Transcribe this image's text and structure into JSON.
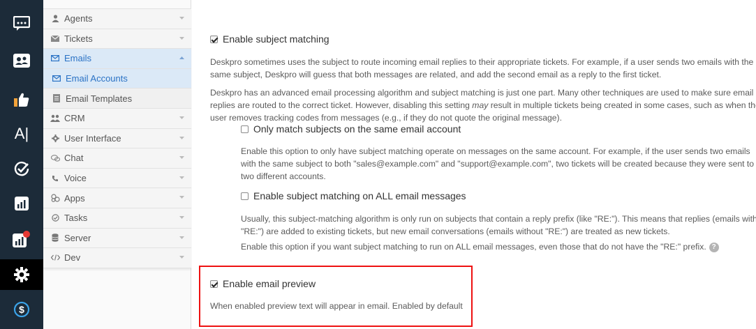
{
  "rail": {
    "items": [
      {
        "icon": "chat-window-icon"
      },
      {
        "icon": "contacts-card-icon"
      },
      {
        "icon": "thumbs-up-icon"
      },
      {
        "icon": "text-cursor-icon",
        "label": "A|"
      },
      {
        "icon": "checkmark-circle-icon"
      },
      {
        "icon": "bar-chart-icon"
      },
      {
        "icon": "bar-chart-notification-icon"
      },
      {
        "icon": "gear-icon",
        "active": true
      },
      {
        "icon": "dollar-circle-icon"
      }
    ],
    "notification_color": "#e53935"
  },
  "sidebar": {
    "items": [
      {
        "label": "Agents",
        "icon": "user-icon"
      },
      {
        "label": "Tickets",
        "icon": "envelope-icon"
      },
      {
        "label": "Emails",
        "icon": "envelope-outline-icon",
        "open": true
      },
      {
        "label": "Email Accounts",
        "icon": "envelope-outline-icon",
        "selected": true
      },
      {
        "label": "Email Templates",
        "icon": "document-icon"
      },
      {
        "label": "CRM",
        "icon": "users-icon"
      },
      {
        "label": "User Interface",
        "icon": "gear-small-icon"
      },
      {
        "label": "Chat",
        "icon": "chat-bubbles-icon"
      },
      {
        "label": "Voice",
        "icon": "phone-icon"
      },
      {
        "label": "Apps",
        "icon": "puzzle-icon"
      },
      {
        "label": "Tasks",
        "icon": "check-circle-icon"
      },
      {
        "label": "Server",
        "icon": "database-icon"
      },
      {
        "label": "Dev",
        "icon": "code-icon"
      }
    ]
  },
  "main": {
    "subject_matching": {
      "label": "Enable subject matching",
      "checked": true,
      "desc1": "Deskpro sometimes uses the subject to route incoming email replies to their appropriate tickets. For example, if a user sends two emails with the same subject, Deskpro will guess that both messages are related, and add the second email as a reply to the first ticket.",
      "desc2_a": "Deskpro has an advanced email processing algorithm and subject matching is just one part. Many other techniques are used to make sure email replies are routed to the correct ticket. However, disabling this setting ",
      "desc2_em": "may",
      "desc2_b": " result in multiple tickets being created in some cases, such as when the user removes tracking codes from messages (e.g., if they do not quote the original message)."
    },
    "same_account": {
      "label": "Only match subjects on the same email account",
      "checked": false,
      "desc": "Enable this option to only have subject matching operate on messages on the same account. For example, if the user sends two emails with the same subject to both \"sales@example.com\" and \"support@example.com\", two tickets will be created because they were sent to two different accounts."
    },
    "all_messages": {
      "label": "Enable subject matching on ALL email messages",
      "checked": false,
      "desc1": "Usually, this subject-matching algorithm is only run on subjects that contain a reply prefix (like \"RE:\"). This means that replies (emails with \"RE:\") are added to existing tickets, but new email conversations (emails without \"RE:\") are treated as new tickets.",
      "desc2": "Enable this option if you want subject matching to run on ALL email messages, even those that do not have the \"RE:\" prefix.",
      "help_glyph": "?"
    },
    "email_preview": {
      "label": "Enable email preview",
      "checked": true,
      "desc": "When enabled preview text will appear in email. Enabled by default"
    },
    "highlight_color": "#e11111"
  }
}
